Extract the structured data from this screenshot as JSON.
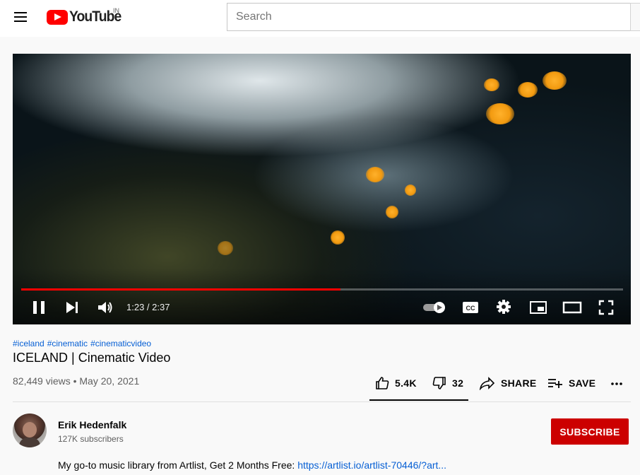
{
  "header": {
    "logo_text": "YouTube",
    "country_code": "IN",
    "search_placeholder": "Search"
  },
  "player": {
    "current_time": "1:23",
    "duration": "2:37",
    "time_text": "1:23 / 2:37",
    "progress": 0.531,
    "accent_color": "#ff0000"
  },
  "video": {
    "hashtags": [
      "#iceland",
      "#cinematic",
      "#cinematicvideo"
    ],
    "title": "ICELAND | Cinematic Video",
    "meta": "82,449 views • May 20, 2021"
  },
  "actions": {
    "likes": "5.4K",
    "dislikes": "32",
    "share_label": "SHARE",
    "save_label": "SAVE"
  },
  "channel": {
    "name": "Erik Hedenfalk",
    "subscribers": "127K subscribers",
    "subscribe_label": "SUBSCRIBE",
    "subscribe_color": "#cc0000"
  },
  "description": {
    "text": "My go-to music library from Artlist, Get 2 Months Free: ",
    "link": "https://artlist.io/artlist-70446/?art..."
  },
  "icons": [
    "menu-icon",
    "youtube-logo-icon",
    "pause-icon",
    "next-icon",
    "volume-icon",
    "autoplay-toggle-icon",
    "captions-icon",
    "settings-icon",
    "miniplayer-icon",
    "theater-icon",
    "fullscreen-icon",
    "like-icon",
    "dislike-icon",
    "share-icon",
    "save-icon",
    "more-icon"
  ]
}
